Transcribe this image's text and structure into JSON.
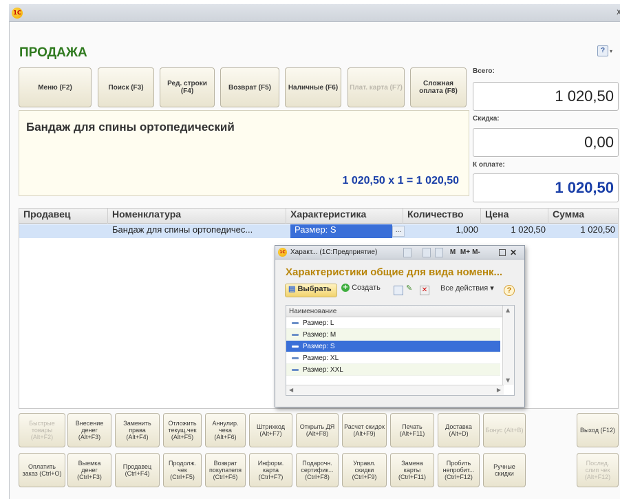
{
  "window": {
    "logo_text": "1С",
    "close_glyph": "x"
  },
  "page": {
    "title": "ПРОДАЖА",
    "help_glyph": "?",
    "help_arrow": "▾"
  },
  "top_buttons": [
    {
      "label": "Меню (F2)",
      "enabled": true
    },
    {
      "label": "Поиск (F3)",
      "enabled": true
    },
    {
      "label": "Ред. строки (F4)",
      "enabled": true
    },
    {
      "label": "Возврат (F5)",
      "enabled": true
    },
    {
      "label": "Наличные (F6)",
      "enabled": true
    },
    {
      "label": "Плат. карта (F7)",
      "enabled": false
    },
    {
      "label": "Сложная оплата (F8)",
      "enabled": true
    }
  ],
  "summary": {
    "total_label": "Всего:",
    "total_value": "1 020,50",
    "discount_label": "Скидка:",
    "discount_value": "0,00",
    "topay_label": "К оплате:",
    "topay_value": "1 020,50"
  },
  "current_item": {
    "name": "Бандаж для спины ортопедический",
    "calc": "1 020,50  x 1  = 1 020,50"
  },
  "table": {
    "columns": [
      "Продавец",
      "Номенклатура",
      "Характеристика",
      "Количество",
      "Цена",
      "Сумма"
    ],
    "rows": [
      {
        "seller": "",
        "item": "Бандаж для спины ортопедичес...",
        "characteristic": "Размер: S",
        "ellipsis": "...",
        "qty": "1,000",
        "price": "1 020,50",
        "sum": "1 020,50"
      }
    ]
  },
  "popup": {
    "window_title": "Характ...  (1С:Предприятие)",
    "title_icons": [
      "M",
      "M+",
      "M-"
    ],
    "heading": "Характеристики общие для вида номенк...",
    "toolbar": {
      "select": "Выбрать",
      "create": "Создать",
      "all_actions": "Все действия ▾",
      "help": "?"
    },
    "list_header": "Наименование",
    "items": [
      "Размер: L",
      "Размер: M",
      "Размер: S",
      "Размер: XL",
      "Размер: XXL"
    ],
    "selected_index": 2
  },
  "bottom_buttons_row1": [
    {
      "label": "Быстрые товары (Alt+F2)",
      "enabled": false
    },
    {
      "label": "Внесение денег (Alt+F3)",
      "enabled": true
    },
    {
      "label": "Заменить права (Alt+F4)",
      "enabled": true
    },
    {
      "label": "Отложить текущ.чек (Alt+F5)",
      "enabled": true
    },
    {
      "label": "Аннулир. чека (Alt+F6)",
      "enabled": true
    },
    {
      "label": "Штрихкод (Alt+F7)",
      "enabled": true
    },
    {
      "label": "Открыть ДЯ (Alt+F8)",
      "enabled": true
    },
    {
      "label": "Расчет скидок (Alt+F9)",
      "enabled": true
    },
    {
      "label": "Печать (Alt+F11)",
      "enabled": true
    },
    {
      "label": "Доставка (Alt+D)",
      "enabled": true
    },
    {
      "label": "Бонус (Alt+B)",
      "enabled": false
    },
    {
      "label": "Выход (F12)",
      "enabled": true
    }
  ],
  "bottom_buttons_row2": [
    {
      "label": "Оплатить заказ (Ctrl+O)",
      "enabled": true
    },
    {
      "label": "Выемка денег (Ctrl+F3)",
      "enabled": true
    },
    {
      "label": "Продавец (Ctrl+F4)",
      "enabled": true
    },
    {
      "label": "Продолж. чек (Ctrl+F5)",
      "enabled": true
    },
    {
      "label": "Возврат покупателя (Ctrl+F6)",
      "enabled": true
    },
    {
      "label": "Информ. карта (Ctrl+F7)",
      "enabled": true
    },
    {
      "label": "Подарочн. сертифик... (Ctrl+F8)",
      "enabled": true
    },
    {
      "label": "Управл. скидки (Ctrl+F9)",
      "enabled": true
    },
    {
      "label": "Замена карты (Ctrl+F11)",
      "enabled": true
    },
    {
      "label": "Пробить непробит... (Ctrl+F12)",
      "enabled": true
    },
    {
      "label": "Ручные скидки",
      "enabled": true
    },
    {
      "label": "Послед. слип чек (Alt+F12)",
      "enabled": false
    }
  ]
}
